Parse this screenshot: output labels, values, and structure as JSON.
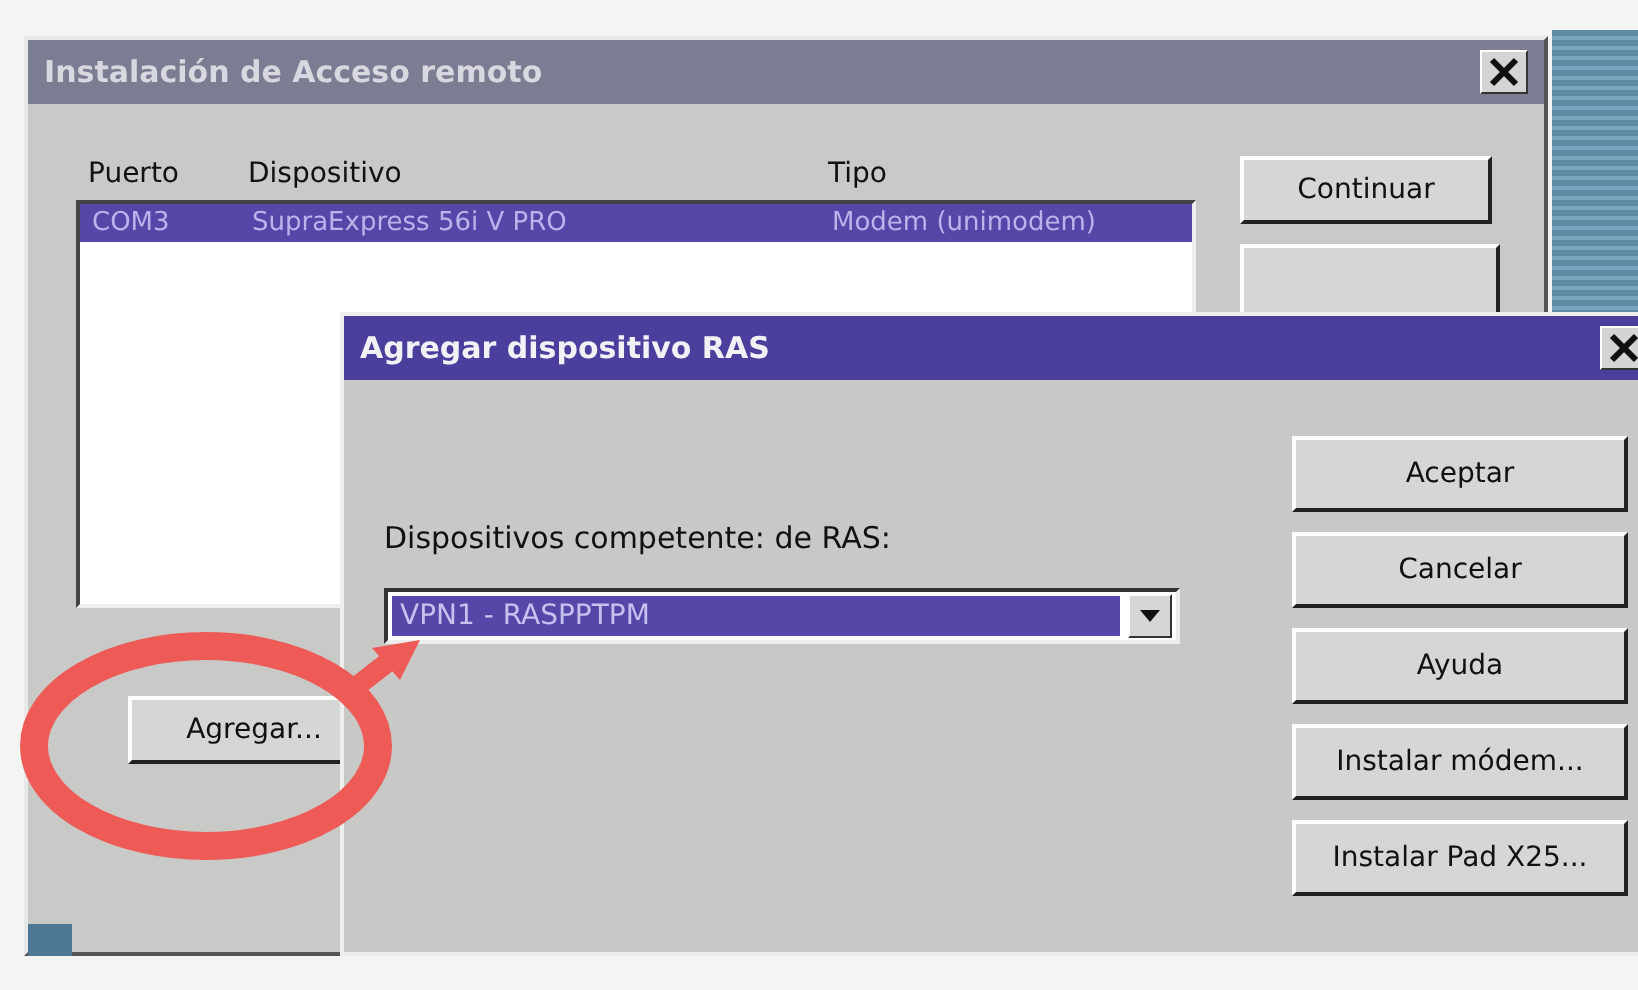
{
  "main_window": {
    "title": "Instalación de Acceso remoto",
    "list": {
      "columns": [
        "Puerto",
        "Dispositivo",
        "Tipo"
      ],
      "rows": [
        {
          "cells": [
            "COM3",
            "SupraExpress 56i V PRO",
            "Modem (unimodem)"
          ],
          "selected": true
        }
      ]
    },
    "buttons": [
      {
        "label": "Continuar"
      }
    ],
    "add_button": {
      "label": "Agregar..."
    }
  },
  "dialog": {
    "title": "Agregar dispositivo RAS",
    "label": "Dispositivos competente: de RAS:",
    "combo": {
      "value": "VPN1 - RASPPTPM"
    },
    "buttons": [
      {
        "label": "Aceptar"
      },
      {
        "label": "Cancelar"
      },
      {
        "label": "Ayuda"
      },
      {
        "label": "Instalar módem..."
      },
      {
        "label": "Instalar Pad X25..."
      }
    ]
  }
}
